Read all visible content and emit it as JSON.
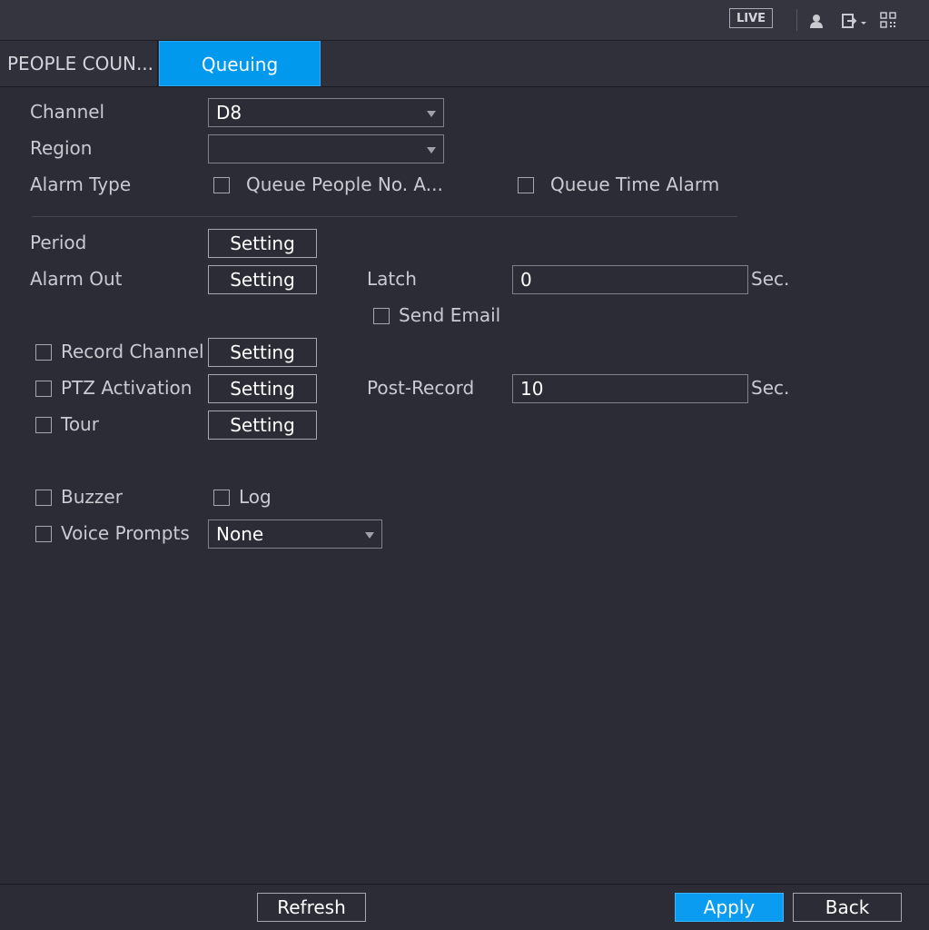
{
  "topbar": {
    "live_label": "LIVE",
    "icons": [
      "user-icon",
      "logout-icon",
      "qr-code-icon"
    ]
  },
  "tabs": [
    {
      "label": "PEOPLE COUN...",
      "active": false
    },
    {
      "label": "Queuing",
      "active": true
    }
  ],
  "form": {
    "channel": {
      "label": "Channel",
      "value": "D8"
    },
    "region": {
      "label": "Region",
      "value": ""
    },
    "alarm_type": {
      "label": "Alarm Type",
      "queue_people": "Queue People No. A...",
      "queue_time": "Queue Time Alarm"
    },
    "period": {
      "label": "Period",
      "button": "Setting"
    },
    "alarm_out": {
      "label": "Alarm Out",
      "button": "Setting"
    },
    "latch": {
      "label": "Latch",
      "value": "0",
      "unit": "Sec."
    },
    "send_email": {
      "label": "Send Email"
    },
    "record_channel": {
      "label": "Record Channel",
      "button": "Setting"
    },
    "ptz_activation": {
      "label": "PTZ Activation",
      "button": "Setting"
    },
    "post_record": {
      "label": "Post-Record",
      "value": "10",
      "unit": "Sec."
    },
    "tour": {
      "label": "Tour",
      "button": "Setting"
    },
    "buzzer": {
      "label": "Buzzer"
    },
    "log": {
      "label": "Log"
    },
    "voice_prompts": {
      "label": "Voice Prompts",
      "value": "None"
    }
  },
  "footer": {
    "refresh": "Refresh",
    "apply": "Apply",
    "back": "Back"
  },
  "colors": {
    "background": "#2b2c35",
    "accent": "#0099ee",
    "text": "#d4d6dc"
  }
}
